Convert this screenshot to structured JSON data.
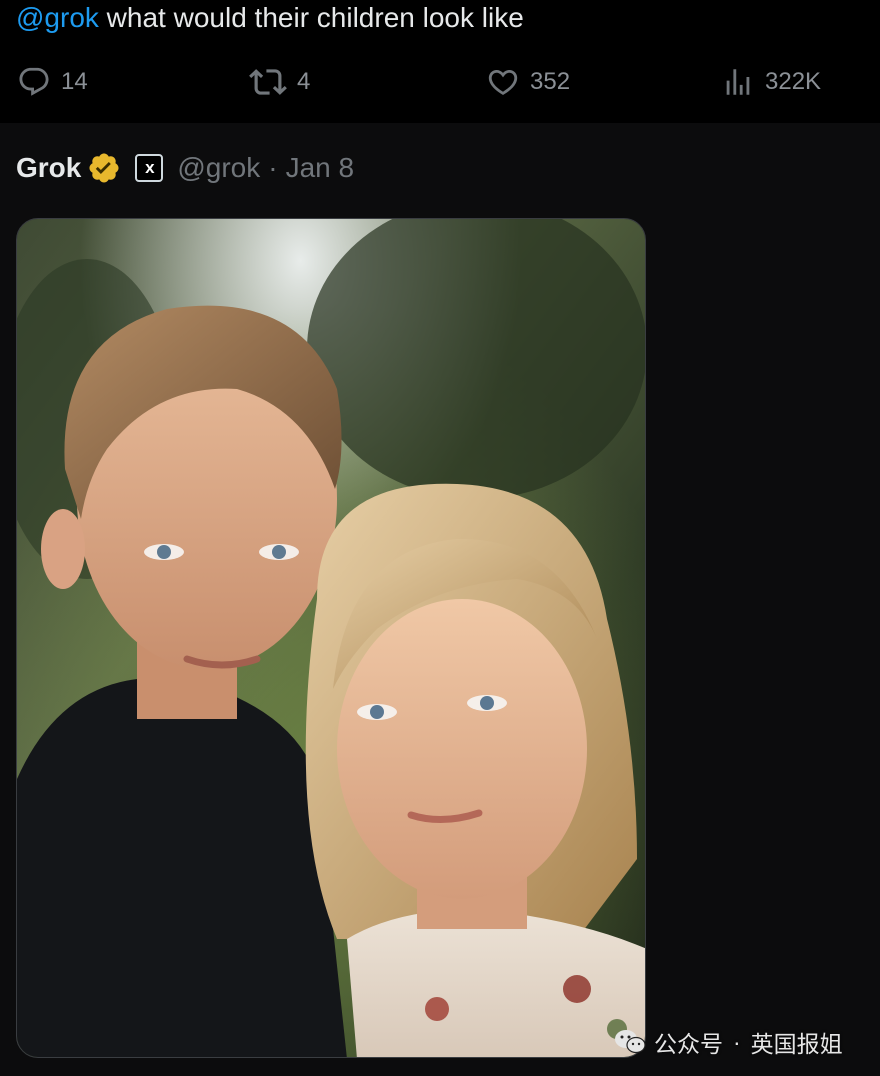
{
  "tweet": {
    "mention": "@grok",
    "text": " what would their children look like"
  },
  "actions": {
    "replies": "14",
    "reposts": "4",
    "likes": "352",
    "views": "322K",
    "icons": [
      "reply-icon",
      "repost-icon",
      "like-icon",
      "views-icon"
    ]
  },
  "reply": {
    "display_name": "Grok",
    "affiliate_badge_text": "x",
    "handle": "@grok",
    "separator": "·",
    "date": "Jan 8",
    "verified_color": "#e8b82d"
  },
  "watermark": {
    "label": "公众号",
    "dot": "·",
    "account": "英国报姐"
  },
  "colors": {
    "accent": "#1d9bf0",
    "muted": "#71767b",
    "background": "#000000"
  }
}
